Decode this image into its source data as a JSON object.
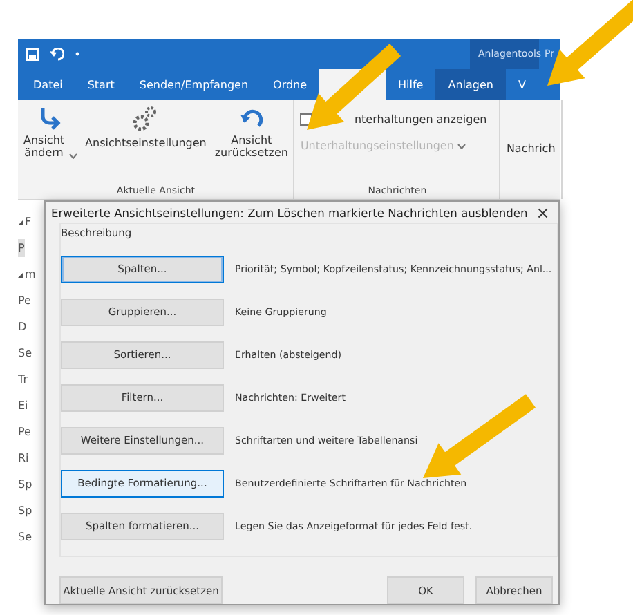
{
  "title_bar": {
    "context_group": "Anlagentools",
    "cut_tab": "Pr"
  },
  "tabs": [
    {
      "label": "Datei",
      "selected": false,
      "kind": "normal"
    },
    {
      "label": "Start",
      "selected": false,
      "kind": "normal"
    },
    {
      "label": "Senden/Empfangen",
      "selected": false,
      "kind": "normal"
    },
    {
      "label": "Ordne",
      "selected": false,
      "kind": "normal"
    },
    {
      "selected": true,
      "kind": "normal"
    },
    {
      "label": "Hilfe",
      "selected": false,
      "kind": "normal"
    },
    {
      "label": "Anlagen",
      "selected": false,
      "kind": "context"
    },
    {
      "label": "V",
      "selected": false,
      "kind": "normal"
    }
  ],
  "ribbon": {
    "groups": [
      {
        "label": "Aktuelle Ansicht",
        "items": [
          {
            "kind": "large",
            "label": "Ansicht\nändern",
            "dropdown": true
          },
          {
            "kind": "large",
            "label": "Ansichtseinstellungen",
            "dropdown": false
          },
          {
            "kind": "large",
            "label": "Ansicht\nzurücksetzen",
            "dropdown": false
          }
        ]
      },
      {
        "label": "Nachrichten",
        "items": [
          {
            "kind": "checkbox",
            "label": "nterhaltungen anzeigen",
            "checked": false
          },
          {
            "kind": "small",
            "label": "Unterhaltungseinstellungen",
            "disabled": true,
            "dropdown": true
          }
        ]
      },
      {
        "items": [
          {
            "kind": "large",
            "label": "Nachrich",
            "dropdown": false
          }
        ]
      }
    ]
  },
  "folder_pane": [
    {
      "label": "F",
      "expander": true,
      "selected": false
    },
    {
      "label": "P",
      "expander": false,
      "selected": true
    },
    {
      "label": "m",
      "expander": true,
      "selected": false
    },
    {
      "label": "Pe",
      "expander": false,
      "selected": false
    },
    {
      "label": "D",
      "expander": false,
      "selected": false
    },
    {
      "label": "Se",
      "expander": false,
      "selected": false
    },
    {
      "label": "Tr",
      "expander": false,
      "selected": false
    },
    {
      "label": "Ei",
      "expander": false,
      "selected": false
    },
    {
      "label": "Pe",
      "expander": false,
      "selected": false
    },
    {
      "label": "Ri",
      "expander": false,
      "selected": false
    },
    {
      "label": "Sp",
      "expander": false,
      "selected": false
    },
    {
      "label": "Sp",
      "expander": false,
      "selected": false
    },
    {
      "label": "Se",
      "expander": false,
      "selected": false
    }
  ],
  "dialog": {
    "title": "Erweiterte Ansichtseinstellungen: Zum Löschen markierte Nachrichten ausblenden",
    "close": "×",
    "group_label": "Beschreibung",
    "rows": [
      {
        "button": "Spalten...",
        "description": "Priorität; Symbol; Kopfzeilenstatus; Kennzeichnungsstatus; Anl...",
        "focused": true,
        "hovered": false
      },
      {
        "button": "Gruppieren...",
        "description": "Keine Gruppierung",
        "focused": false,
        "hovered": false
      },
      {
        "button": "Sortieren...",
        "description": "Erhalten (absteigend)",
        "focused": false,
        "hovered": false
      },
      {
        "button": "Filtern...",
        "description": "Nachrichten: Erweitert",
        "focused": false,
        "hovered": false
      },
      {
        "button": "Weitere Einstellungen...",
        "description": "Schriftarten und weitere Tabellenansi",
        "focused": false,
        "hovered": false
      },
      {
        "button": "Bedingte Formatierung...",
        "description": "Benutzerdefinierte Schriftarten für Nachrichten",
        "focused": false,
        "hovered": true
      },
      {
        "button": "Spalten formatieren...",
        "description": "Legen Sie das Anzeigeformat für jedes Feld fest.",
        "focused": false,
        "hovered": false
      }
    ],
    "reset_button": "Aktuelle Ansicht zurücksetzen",
    "buttons": [
      "OK",
      "Abbrechen"
    ]
  }
}
